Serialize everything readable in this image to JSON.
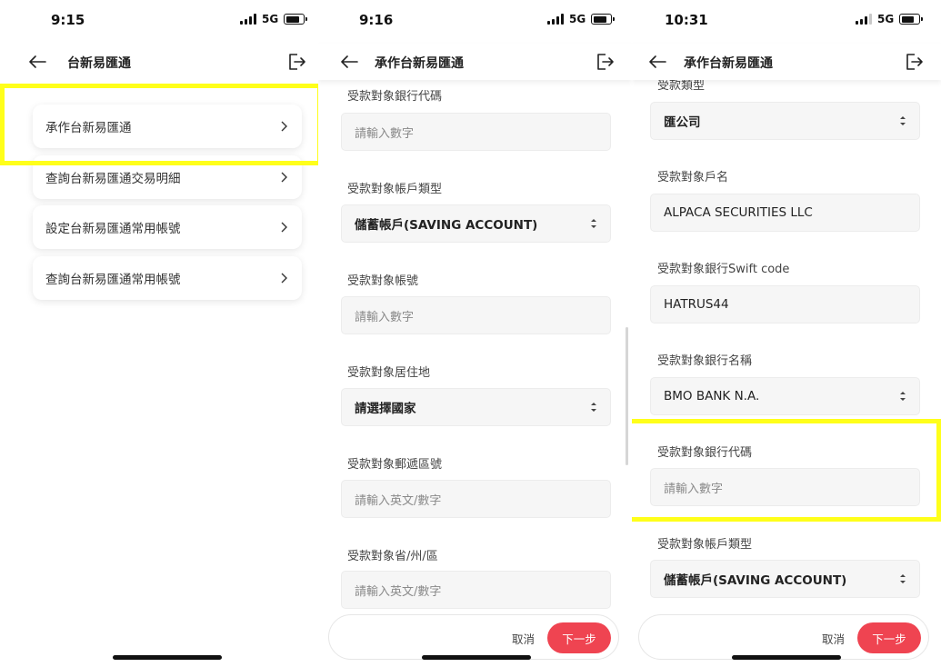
{
  "colors": {
    "highlight": "#ffff1a",
    "primary_button": "#ef4451"
  },
  "screen1": {
    "time": "9:15",
    "network": "5G",
    "nav_title": "台新易匯通",
    "menu": [
      {
        "label": "承作台新易匯通"
      },
      {
        "label": "查詢台新易匯通交易明細"
      },
      {
        "label": "設定台新易匯通常用帳號"
      },
      {
        "label": "查詢台新易匯通常用帳號"
      }
    ]
  },
  "screen2": {
    "time": "9:16",
    "network": "5G",
    "nav_title": "承作台新易匯通",
    "fields": [
      {
        "label": "受款對象銀行代碼",
        "placeholder": "請輸入數字"
      },
      {
        "label": "受款對象帳戶類型",
        "value": "儲蓄帳戶(SAVING ACCOUNT)"
      },
      {
        "label": "受款對象帳號",
        "placeholder": "請輸入數字"
      },
      {
        "label": "受款對象居住地",
        "value": "請選擇國家"
      },
      {
        "label": "受款對象郵遞區號",
        "placeholder": "請輸入英文/數字"
      },
      {
        "label": "受款對象省/州/區",
        "placeholder": "請輸入英文/數字"
      }
    ],
    "cancel": "取消",
    "next": "下一步"
  },
  "screen3": {
    "time": "10:31",
    "network": "5G",
    "nav_title": "承作台新易匯通",
    "fields": [
      {
        "label": "受款類型",
        "value": "匯公司"
      },
      {
        "label": "受款對象戶名",
        "value": "ALPACA SECURITIES LLC"
      },
      {
        "label": "受款對象銀行Swift code",
        "value": "HATRUS44"
      },
      {
        "label": "受款對象銀行名稱",
        "value": "BMO BANK N.A."
      },
      {
        "label": "受款對象銀行代碼",
        "placeholder": "請輸入數字"
      },
      {
        "label": "受款對象帳戶類型",
        "value": "儲蓄帳戶(SAVING ACCOUNT)"
      }
    ],
    "cancel": "取消",
    "next": "下一步"
  }
}
